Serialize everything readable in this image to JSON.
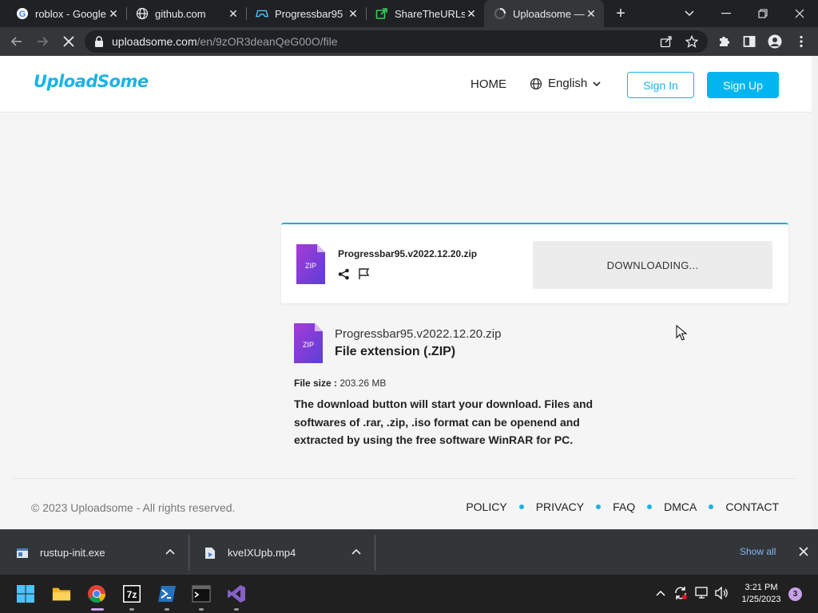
{
  "browser": {
    "tabs": [
      {
        "title": "roblox - Google",
        "icon": "google-icon"
      },
      {
        "title": "github.com",
        "icon": "globe-icon"
      },
      {
        "title": "Progressbar95 F",
        "icon": "gamepad-icon"
      },
      {
        "title": "ShareTheURLs –",
        "icon": "share-arrow-icon"
      },
      {
        "title": "Uploadsome —",
        "icon": "loading-spinner-icon",
        "active": true
      }
    ],
    "url_host": "uploadsome.com",
    "url_path": "/en/9zOR3deanQeG00O/file"
  },
  "site": {
    "logo": "UploadSome",
    "nav_home": "HOME",
    "nav_language": "English",
    "sign_in": "Sign In",
    "sign_up": "Sign Up",
    "accent_color": "#1ab3e6"
  },
  "card": {
    "zip_label": "ZIP",
    "filename": "Progressbar95.v2022.12.20.zip",
    "download_status": "DOWNLOADING..."
  },
  "info": {
    "zip_label": "ZIP",
    "filename": "Progressbar95.v2022.12.20.zip",
    "extension": "File extension (.ZIP)",
    "size_label": "File size :",
    "size_value": "203.26 MB",
    "description": "The download button will start your download. Files and softwares of .rar, .zip, .iso format can be openend and extracted by using the free software WinRAR for PC."
  },
  "footer": {
    "copyright": "© 2023 Uploadsome - All rights reserved.",
    "links": [
      "POLICY",
      "PRIVACY",
      "FAQ",
      "DMCA",
      "CONTACT"
    ]
  },
  "downloads": {
    "items": [
      "rustup-init.exe",
      "kveIXUpb.mp4"
    ],
    "show_all": "Show all"
  },
  "taskbar": {
    "icons": [
      "windows-start-icon",
      "file-explorer-icon",
      "chrome-icon",
      "7zip-icon",
      "powershell-icon",
      "terminal-icon",
      "visual-studio-icon"
    ],
    "time": "3:21 PM",
    "date": "1/25/2023",
    "notification_count": "3"
  }
}
